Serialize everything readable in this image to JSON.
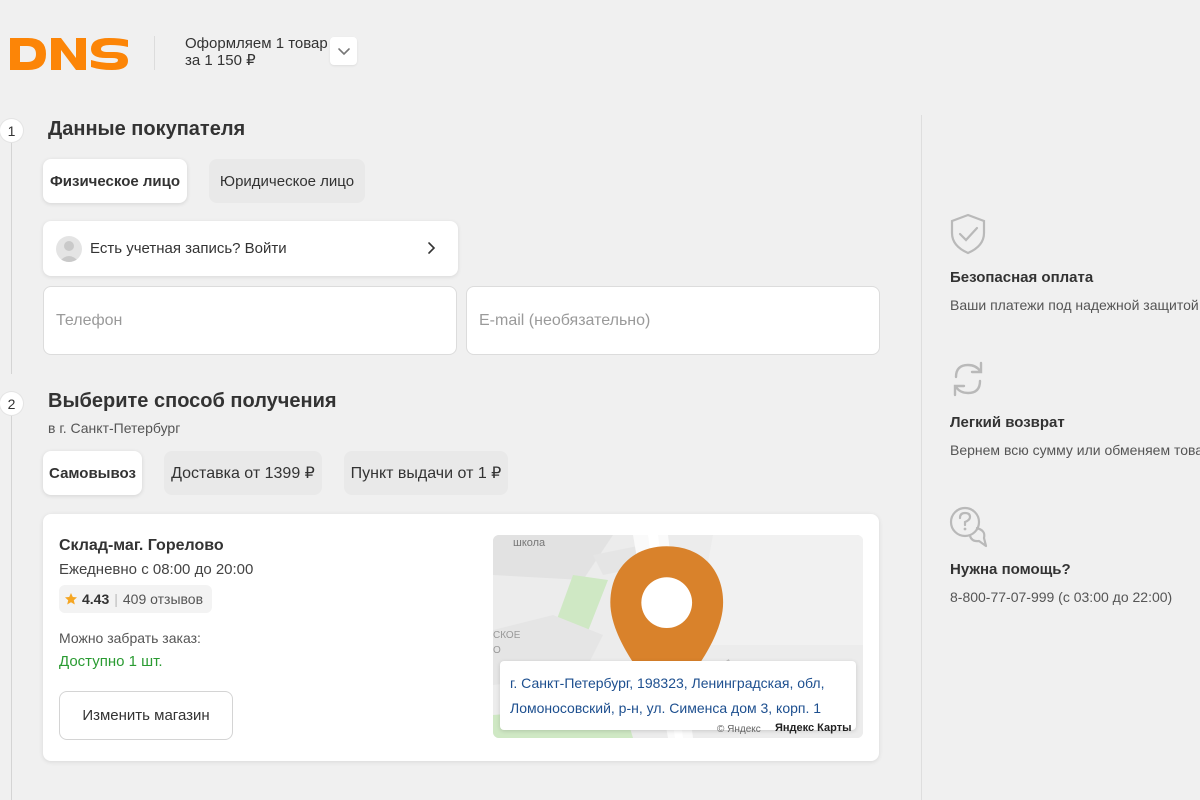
{
  "header": {
    "logo_text": "DNS",
    "order_line1": "Оформляем 1 товар",
    "order_line2": "за 1 150 ₽"
  },
  "step1": {
    "number": "1",
    "title": "Данные покупателя",
    "tabs": [
      {
        "label": "Физическое лицо",
        "active": true
      },
      {
        "label": "Юридическое лицо",
        "active": false
      }
    ],
    "login_prompt": "Есть учетная запись? Войти",
    "phone_placeholder": "Телефон",
    "email_placeholder": "E-mail (необязательно)"
  },
  "step2": {
    "number": "2",
    "title": "Выберите способ получения",
    "city": "в г. Санкт-Петербург",
    "tabs": [
      {
        "label": "Самовывоз",
        "active": true
      },
      {
        "label": "Доставка от 1399 ₽",
        "active": false
      },
      {
        "label": "Пункт выдачи от 1 ₽",
        "active": false
      }
    ],
    "store": {
      "name": "Склад-маг. Горелово",
      "hours": "Ежедневно с 08:00 до 20:00",
      "rating": "4.43",
      "reviews": "409 отзывов",
      "pickup_label": "Можно забрать заказ:",
      "availability": "Доступно 1 шт.",
      "change_button": "Изменить магазин"
    },
    "map": {
      "label_school": "школа",
      "label_skoe": "СКОЕ",
      "label_o": "О",
      "address_line1": "г. Санкт-Петербург, 198323, Ленинградская, обл,",
      "address_line2": "Ломоносовский, р-н, ул. Сименса дом 3, корп. 1",
      "copyright": "© Яндекс",
      "brand": "Яндекс Карты"
    }
  },
  "sidebar": {
    "items": [
      {
        "icon": "shield-check-icon",
        "title": "Безопасная оплата",
        "text": "Ваши платежи под надежной защитой"
      },
      {
        "icon": "refresh-icon",
        "title": "Легкий возврат",
        "text": "Вернем всю сумму или обменяем товар"
      },
      {
        "icon": "help-chat-icon",
        "title": "Нужна помощь?",
        "text": "8-800-77-07-999 (с 03:00 до 22:00)"
      }
    ]
  },
  "colors": {
    "brand_orange": "#fc8507",
    "available_green": "#2a9b32",
    "address_blue": "#1d4f8f",
    "rating_star": "#f5a623"
  }
}
